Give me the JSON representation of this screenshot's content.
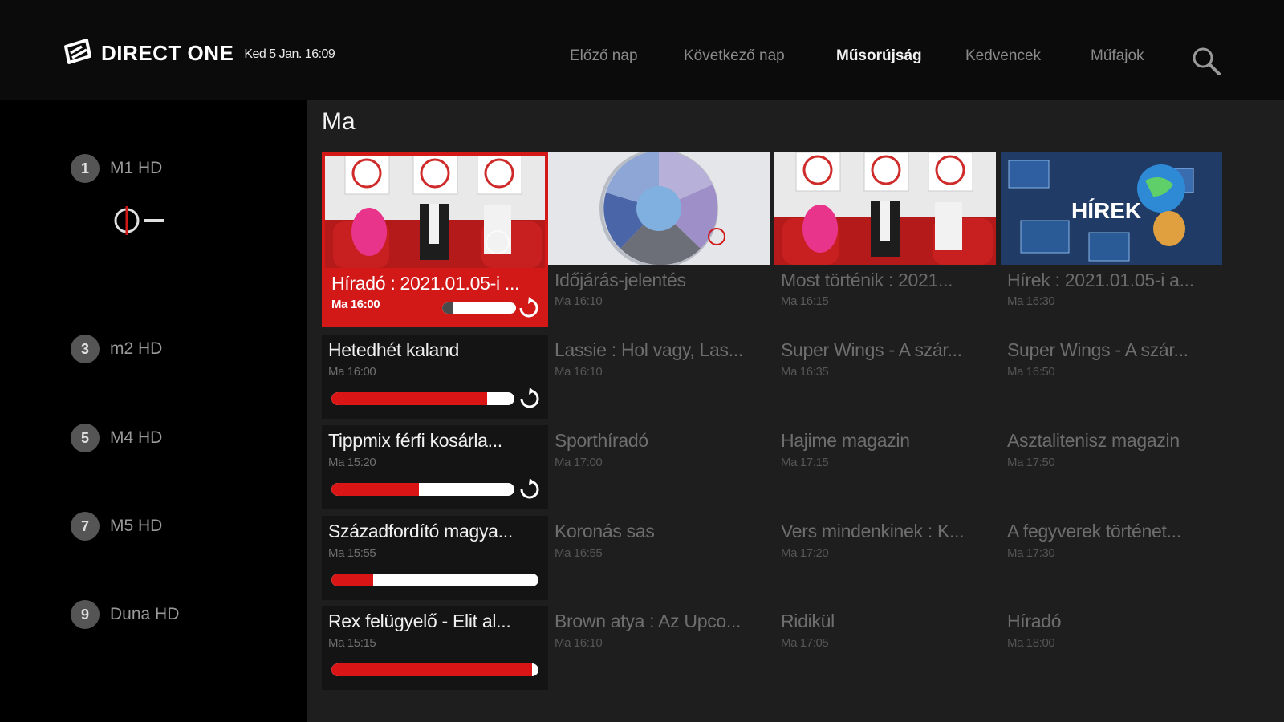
{
  "header": {
    "brand": "DIRECT ONE",
    "datetime": "Ked 5 Jan. 16:09",
    "nav": [
      "Előző nap",
      "Következő nap",
      "Műsorújság",
      "Kedvencek",
      "Műfajok"
    ],
    "active_nav": "Műsorújság"
  },
  "sidebar": {
    "channels": [
      {
        "num": "1",
        "name": "M1 HD"
      },
      {
        "num": "3",
        "name": "m2 HD"
      },
      {
        "num": "5",
        "name": "M4 HD"
      },
      {
        "num": "7",
        "name": "M5 HD"
      },
      {
        "num": "9",
        "name": "Duna HD"
      }
    ]
  },
  "main": {
    "section_title": "Ma",
    "rows": [
      [
        {
          "title": "Híradó : 2021.01.05-i ...",
          "time": "Ma 16:00",
          "progress": 0.15,
          "state": "focused"
        },
        {
          "title": "Időjárás-jelentés",
          "time": "Ma 16:10"
        },
        {
          "title": "Most történik : 2021...",
          "time": "Ma 16:15"
        },
        {
          "title": "Hírek : 2021.01.05-i a...",
          "time": "Ma 16:30"
        }
      ],
      [
        {
          "title": "Hetedhét kaland",
          "time": "Ma 16:00",
          "progress": 0.85,
          "state": "live"
        },
        {
          "title": "Lassie : Hol vagy, Las...",
          "time": "Ma 16:10"
        },
        {
          "title": "Super Wings - A szár...",
          "time": "Ma 16:35"
        },
        {
          "title": "Super Wings - A szár...",
          "time": "Ma 16:50"
        }
      ],
      [
        {
          "title": "Tippmix férfi kosárla...",
          "time": "Ma 15:20",
          "progress": 0.48,
          "state": "live"
        },
        {
          "title": "Sporthíradó",
          "time": "Ma 17:00"
        },
        {
          "title": "Hajime magazin",
          "time": "Ma 17:15"
        },
        {
          "title": "Asztalitenisz magazin",
          "time": "Ma 17:50"
        }
      ],
      [
        {
          "title": "Századfordító magya...",
          "time": "Ma 15:55",
          "progress": 0.2,
          "state": "live"
        },
        {
          "title": "Koronás sas",
          "time": "Ma 16:55"
        },
        {
          "title": "Vers mindenkinek : K...",
          "time": "Ma 17:20"
        },
        {
          "title": "A fegyverek történet...",
          "time": "Ma 17:30"
        }
      ],
      [
        {
          "title": "Rex felügyelő - Elit al...",
          "time": "Ma 15:15",
          "progress": 0.97,
          "state": "live"
        },
        {
          "title": "Brown atya : Az Upco...",
          "time": "Ma 16:10"
        },
        {
          "title": "Ridikül",
          "time": "Ma 17:05"
        },
        {
          "title": "Híradó",
          "time": "Ma 18:00"
        }
      ]
    ],
    "thumb_labels": {
      "hirek": "HÍREK"
    }
  },
  "colors": {
    "accent": "#d31818",
    "background": "#1e1e1e"
  }
}
